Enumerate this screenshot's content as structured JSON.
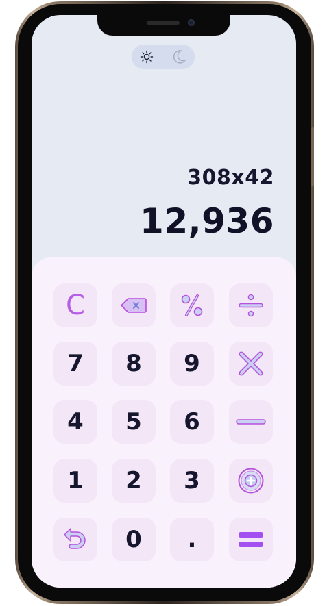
{
  "theme_toggle": {
    "light_icon": "sun-icon",
    "dark_icon": "moon-icon",
    "active": "light"
  },
  "display": {
    "expression": "308x42",
    "result": "12,936"
  },
  "keypad": {
    "clear": {
      "icon": "clear-icon",
      "label": "C"
    },
    "backspace": {
      "icon": "backspace-icon"
    },
    "percent": {
      "icon": "percent-icon",
      "label": "%"
    },
    "divide": {
      "icon": "divide-icon"
    },
    "seven": "7",
    "eight": "8",
    "nine": "9",
    "multiply": {
      "icon": "multiply-icon"
    },
    "four": "4",
    "five": "5",
    "six": "6",
    "subtract": {
      "icon": "minus-icon"
    },
    "one": "1",
    "two": "2",
    "three": "3",
    "add": {
      "icon": "plus-circle-icon"
    },
    "undo": {
      "icon": "undo-icon"
    },
    "zero": "0",
    "decimal": ".",
    "equals": {
      "icon": "equals-icon"
    }
  },
  "colors": {
    "screen_bg": "#e6eaf2",
    "keypad_bg": "#f9f1fb",
    "key_bg": "#f3e6f6",
    "accent": "#a24ef0",
    "text": "#16162e"
  }
}
